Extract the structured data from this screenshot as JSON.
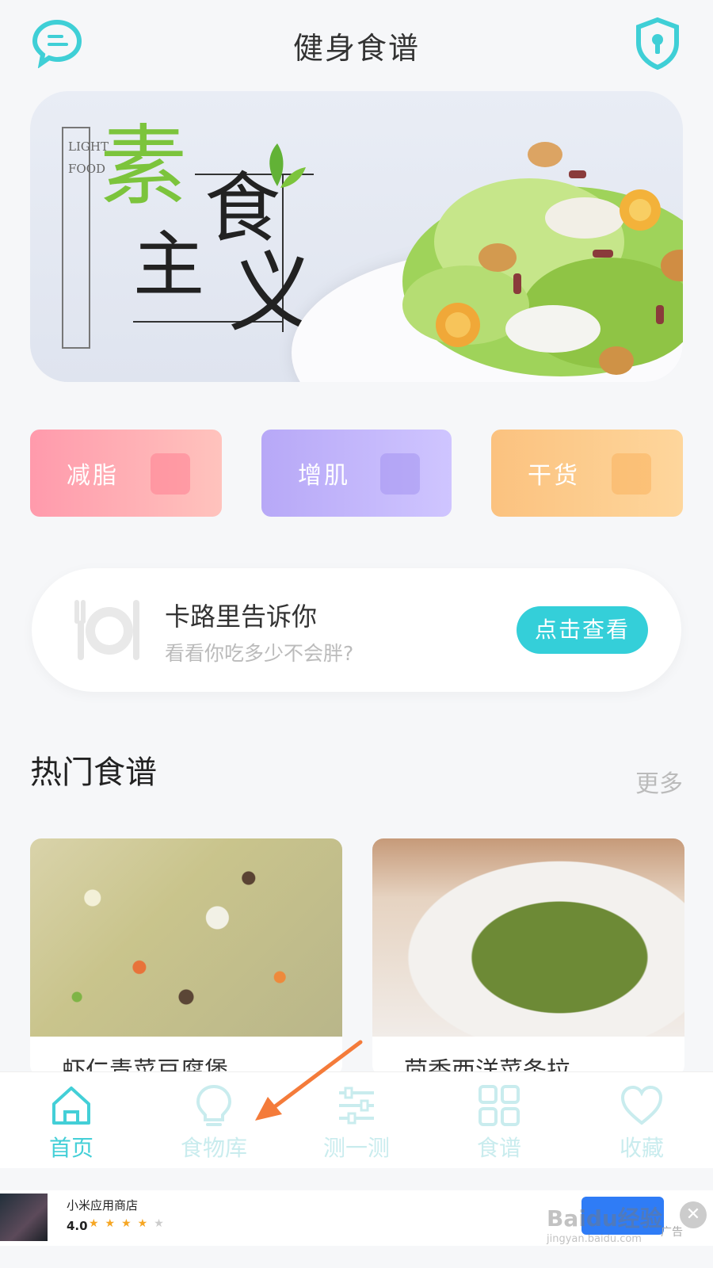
{
  "header": {
    "title": "健身食谱",
    "chat_icon": "chat-bubble-icon",
    "shield_icon": "shield-lock-icon"
  },
  "banner": {
    "side_text": "LIGHT FOOD",
    "char_su": "素",
    "char_zhu": "主",
    "char_shi": "食",
    "char_yi": "义"
  },
  "categories": [
    {
      "label": "减脂",
      "icon": "scale-icon"
    },
    {
      "label": "增肌",
      "icon": "dumbbell-icon"
    },
    {
      "label": "干货",
      "icon": "clipboard-icon"
    }
  ],
  "calorie_card": {
    "title": "卡路里告诉你",
    "subtitle": "看看你吃多少不会胖?",
    "button": "点击查看"
  },
  "hot_recipes": {
    "title": "热门食谱",
    "more": "更多",
    "items": [
      {
        "name": "虾仁青菜豆腐煲"
      },
      {
        "name": "茴香西洋菜条拉"
      }
    ]
  },
  "tabbar": {
    "items": [
      {
        "label": "首页",
        "icon": "home-icon",
        "active": true
      },
      {
        "label": "食物库",
        "icon": "lightbulb-icon",
        "active": false
      },
      {
        "label": "测一测",
        "icon": "sliders-icon",
        "active": false
      },
      {
        "label": "食谱",
        "icon": "grid-icon",
        "active": false
      },
      {
        "label": "收藏",
        "icon": "heart-icon",
        "active": false
      }
    ]
  },
  "ad": {
    "app_name": "小米应用商店",
    "rating": "4.0",
    "stars_on": "★★★★",
    "stars_off": "★",
    "label": "广告",
    "close": "✕"
  },
  "watermark": {
    "main": "Baidu经验",
    "sub": "jingyan.baidu.com"
  },
  "colors": {
    "accent": "#43cfd7",
    "button": "#34cfd9",
    "arrow": "#f47b3a"
  }
}
